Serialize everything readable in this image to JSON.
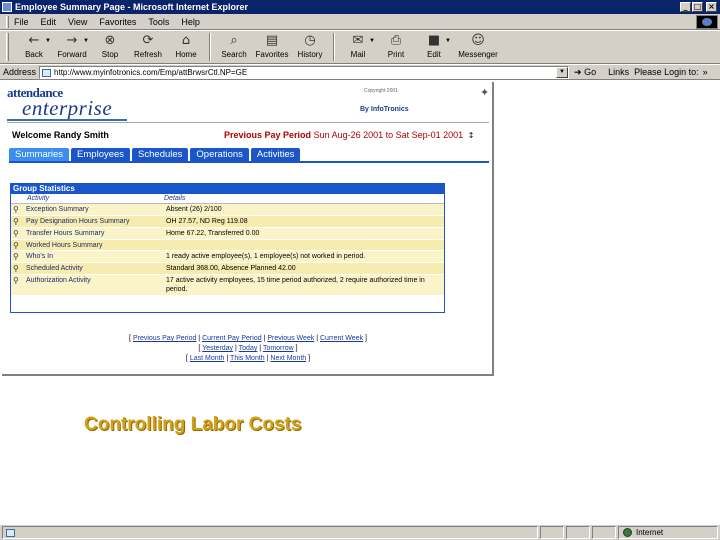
{
  "window": {
    "title": "Employee Summary Page - Microsoft Internet Explorer",
    "controls": [
      "_",
      "□",
      "×"
    ]
  },
  "menu": [
    "File",
    "Edit",
    "View",
    "Favorites",
    "Tools",
    "Help"
  ],
  "toolbar": [
    {
      "label": "Back",
      "icon": "back-arrow-icon"
    },
    {
      "label": "Forward",
      "icon": "forward-arrow-icon"
    },
    {
      "label": "Stop",
      "icon": "stop-icon"
    },
    {
      "label": "Refresh",
      "icon": "refresh-icon"
    },
    {
      "label": "Home",
      "icon": "home-icon"
    },
    {
      "label": "Search",
      "icon": "search-icon"
    },
    {
      "label": "Favorites",
      "icon": "favorites-icon"
    },
    {
      "label": "History",
      "icon": "history-icon"
    },
    {
      "label": "Mail",
      "icon": "mail-icon"
    },
    {
      "label": "Print",
      "icon": "print-icon"
    },
    {
      "label": "Edit",
      "icon": "edit-icon"
    },
    {
      "label": "Messenger",
      "icon": "messenger-icon"
    }
  ],
  "address": {
    "label": "Address",
    "url": "http://www.myinfotronics.com/Emp/attBrwsrCtl.NP=GE",
    "go": "Go",
    "links_label": "Links",
    "links_item": "Please Login to:",
    "links_more": "»"
  },
  "page": {
    "logo_top": "attendance",
    "logo_bottom": "enterprise",
    "copyright": "Copyright 2001",
    "by": "By InfoTronics",
    "welcome": "Welcome Randy Smith",
    "pay_period_label": "Previous Pay Period",
    "pay_period_value": "Sun Aug-26 2001 to Sat Sep-01 2001",
    "pay_period_arrows": "↕",
    "tabs": [
      "Summaries",
      "Employees",
      "Schedules",
      "Operations",
      "Activities"
    ],
    "panel": {
      "title": "Group Statistics",
      "col_activity": "Activity",
      "col_details": "Details",
      "rows": [
        {
          "activity": "Exception Summary",
          "details": "Absent (26) 2/100"
        },
        {
          "activity": "Pay Designation Hours Summary",
          "details": "OH 27.57, ND Reg 119.08"
        },
        {
          "activity": "Transfer Hours Summary",
          "details": "Home 67.22, Transferred 0.00"
        },
        {
          "activity": "Worked Hours Summary",
          "details": ""
        },
        {
          "activity": "Who's In",
          "details": "1 ready active employee(s), 1 employee(s) not worked in period."
        },
        {
          "activity": "Scheduled Activity",
          "details": "Standard 368.00, Absence Planned 42.00"
        },
        {
          "activity": "Authorization Activity",
          "details": "17 active activity employees, 15 time period authorized, 2 require authorized time in period."
        }
      ]
    },
    "nav": {
      "row1": [
        "Previous Pay Period",
        "Current Pay Period",
        "Previous Week",
        "Current Week"
      ],
      "row2": [
        "Yesterday",
        "Today",
        "Tomorrow"
      ],
      "row3": [
        "Last Month",
        "This Month",
        "Next Month"
      ]
    }
  },
  "caption": "Controlling Labor Costs",
  "statusbar": {
    "zone": "Internet"
  }
}
